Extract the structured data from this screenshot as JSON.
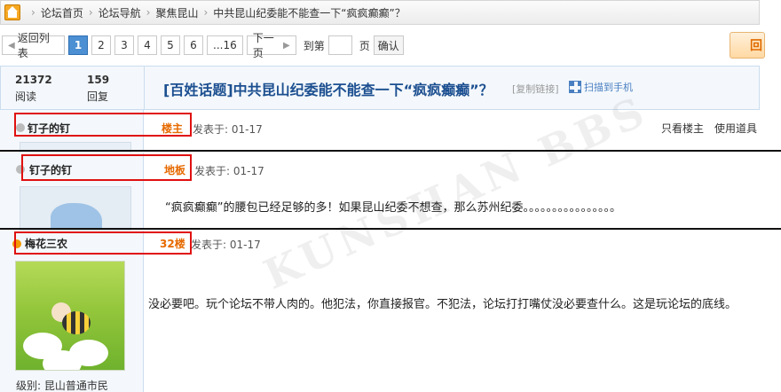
{
  "breadcrumb": {
    "items": [
      "论坛首页",
      "论坛导航",
      "聚焦昆山",
      "中共昆山纪委能不能查一下“疯疯癫癫”？"
    ],
    "separator": "›"
  },
  "pager": {
    "back_label": "返回列表",
    "pages": [
      "1",
      "2",
      "3",
      "4",
      "5",
      "6",
      "...16"
    ],
    "current": "1",
    "next_label": "下一页",
    "goto_label": "到第",
    "page_unit": "页",
    "page_input_value": "",
    "confirm_label": "确认",
    "reply_label": "回"
  },
  "thread": {
    "reads_count": "21372",
    "reads_label": "阅读",
    "replies_count": "159",
    "replies_label": "回复",
    "title": "[百姓话题]中共昆山纪委能不能查一下“疯疯癫癫”？",
    "copy_link_label": "[复制链接]",
    "scan_label": "扫描到手机"
  },
  "posts": [
    {
      "author": "钉子的钉",
      "floor": "楼主",
      "posted": "发表于: 01-17",
      "actions": [
        "只看楼主",
        "使用道具"
      ]
    },
    {
      "author": "钉子的钉",
      "floor": "地板",
      "posted": "发表于: 01-17",
      "body": "“疯疯癫癫”的腰包已经足够的多！如果昆山纪委不想查，那么苏州纪委。。。。。。。。。。。。。。。。"
    },
    {
      "author": "梅花三农",
      "floor": "32楼",
      "posted": "发表于: 01-17",
      "body": "没必要吧。玩个论坛不带人肉的。他犯法，你直接报官。不犯法，论坛打打嘴仗没必要查什么。这是玩论坛的底线。",
      "level": "级别: 昆山普通市民"
    }
  ],
  "watermark": "KUNSHAN BBS",
  "colors": {
    "accent": "#4c8fd3",
    "floor": "#e66a00",
    "title": "#1c4f90",
    "highlight": "#e01010"
  }
}
